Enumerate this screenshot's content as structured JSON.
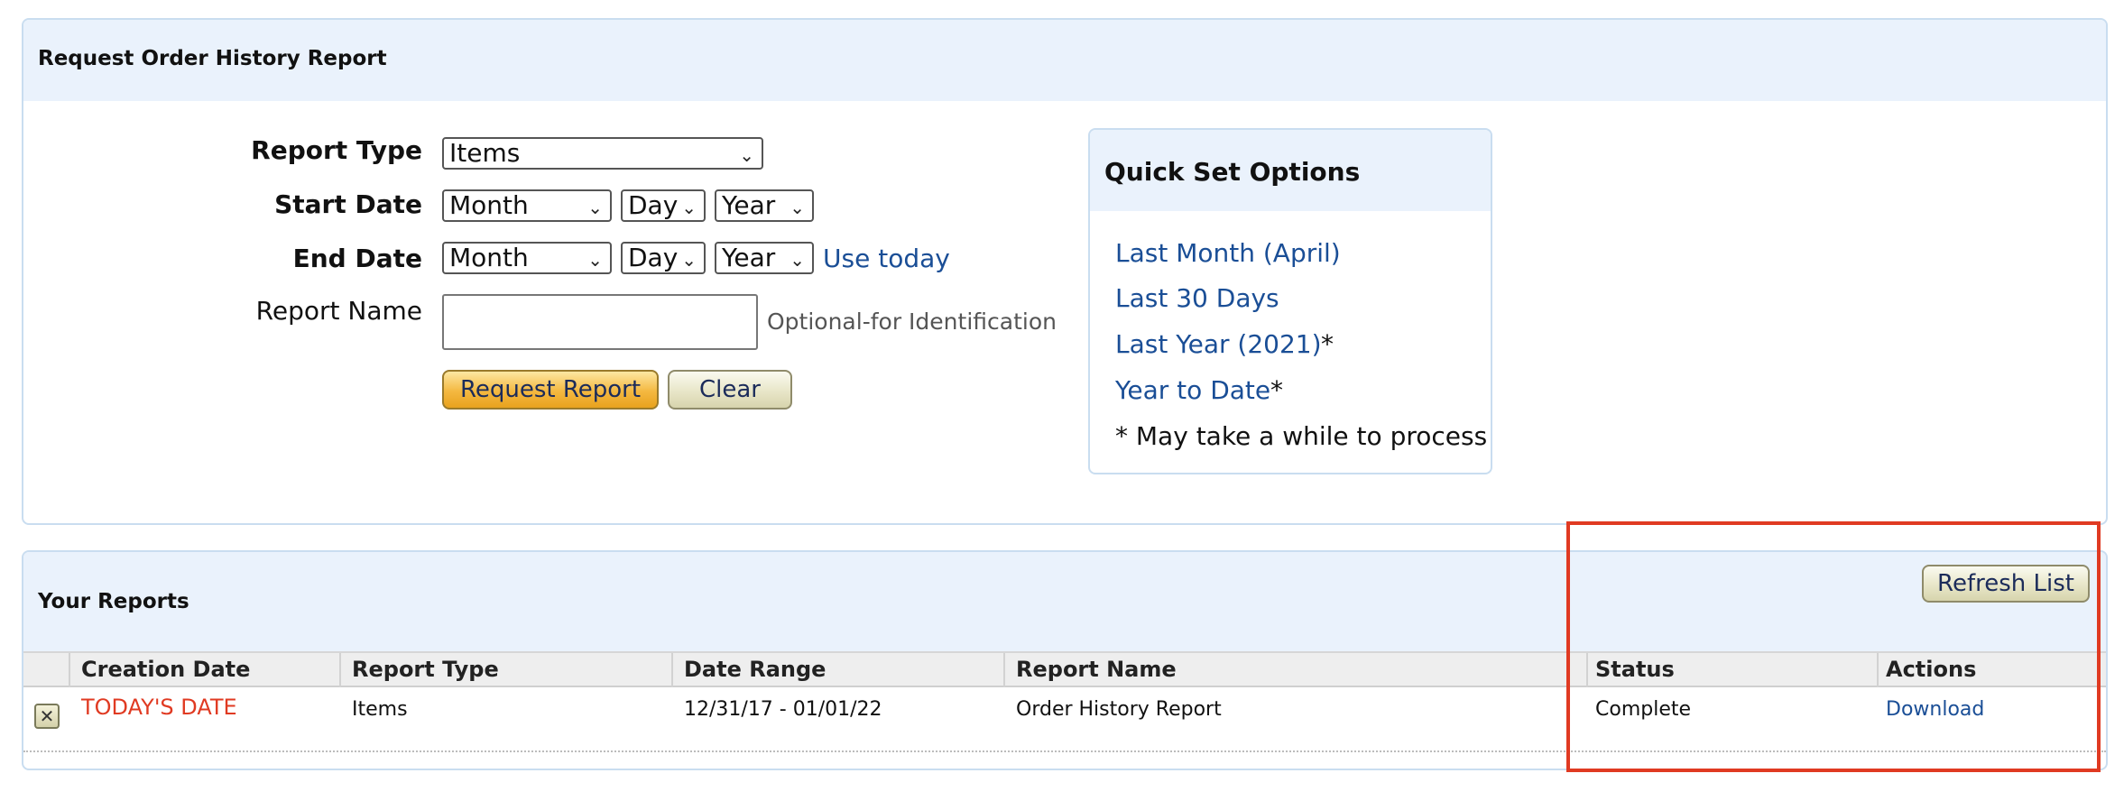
{
  "request_panel": {
    "title": "Request Order History Report",
    "report_type_label": "Report Type",
    "report_type_value": "Items",
    "start_date_label": "Start Date",
    "end_date_label": "End Date",
    "month_value": "Month",
    "day_value": "Day",
    "year_value": "Year",
    "use_today": "Use today",
    "report_name_label": "Report Name",
    "report_name_value": "",
    "report_name_hint": "Optional-for Identification",
    "request_button": "Request Report",
    "clear_button": "Clear"
  },
  "quick_set": {
    "title": "Quick Set Options",
    "options": [
      "Last Month (April)",
      "Last 30 Days",
      "Last Year (2021)",
      "Year to Date"
    ],
    "asterisk": "*",
    "note": "* May take a while to process"
  },
  "reports_panel": {
    "title": "Your Reports",
    "refresh_button": "Refresh List",
    "columns": [
      "Creation Date",
      "Report Type",
      "Date Range",
      "Report Name",
      "Status",
      "Actions"
    ],
    "rows": [
      {
        "creation_date": "TODAY'S DATE",
        "report_type": "Items",
        "date_range": "12/31/17 - 01/01/22",
        "report_name": "Order History Report",
        "status": "Complete",
        "action": "Download"
      }
    ]
  },
  "icons": {
    "delete": "close-icon",
    "dropdown": "chevron-down-icon"
  },
  "colors": {
    "header_bg": "#eaf2fc",
    "link": "#1a4e96",
    "accent_red": "#e03a22",
    "highlight": "#e03a22"
  }
}
